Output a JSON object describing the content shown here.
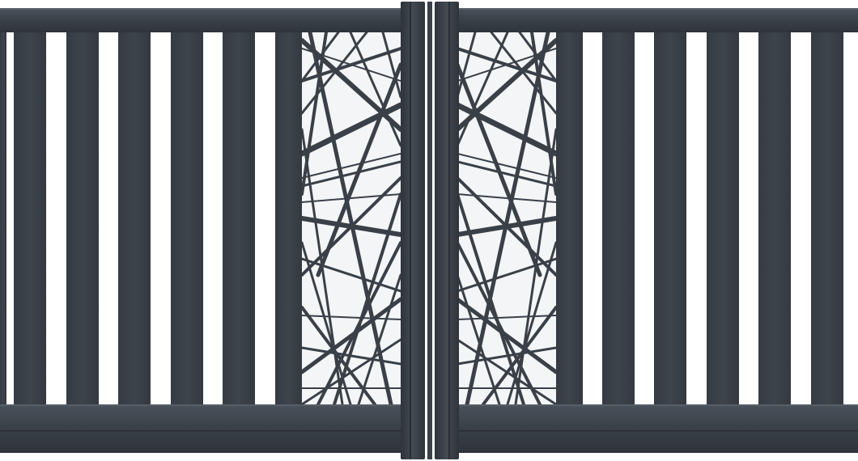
{
  "gate": {
    "colors": {
      "frame": "#3a4048",
      "frame_highlight": "#4a515a",
      "frame_shadow": "#2d3238",
      "background": "#ffffff"
    },
    "left_leaf": {
      "slat_count": 6,
      "decorative_panel": "abstract-lines"
    },
    "right_leaf": {
      "slat_count": 6,
      "decorative_panel": "abstract-lines"
    }
  }
}
